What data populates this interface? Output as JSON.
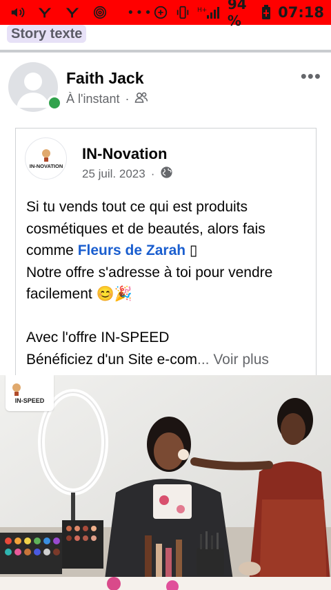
{
  "status_bar": {
    "battery": "94 %",
    "time": "07:18",
    "network": "H+"
  },
  "story_chip": "Story texte",
  "post": {
    "author": "Faith Jack",
    "time": "À l'instant",
    "separator": "·",
    "audience_icon": "friends-icon",
    "more_label": "•••"
  },
  "shared": {
    "page_name": "IN-Novation",
    "date": "25 juil. 2023",
    "separator": "·",
    "audience_icon": "globe-icon",
    "logo_text": "IN-NOVATION",
    "text": {
      "line1": "Si tu vends tout ce qui est produits",
      "line2": "cosmétiques et de beautés, alors fais",
      "line3_pre": "comme ",
      "line3_link": "Fleurs de Zarah",
      "line3_post": " ▯",
      "line4": "Notre offre s'adresse à toi pour vendre",
      "line5": "facilement 😊🎉",
      "line6": "Avec l'offre IN-SPEED",
      "line7_pre": "Bénéficiez d'un Site e-com",
      "line7_ellipsis": "... ",
      "see_more": "Voir plus"
    },
    "image_badge": "IN-SPEED"
  },
  "colors": {
    "status_bar": "#ff0000",
    "link": "#1a5ecf",
    "online": "#31a24c",
    "chip_bg": "#e7e1f7"
  }
}
